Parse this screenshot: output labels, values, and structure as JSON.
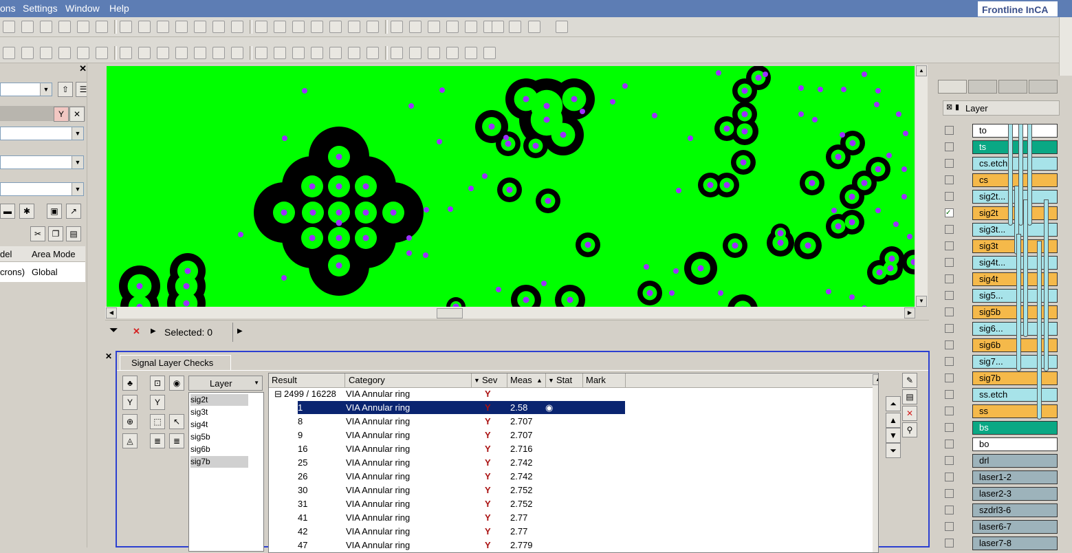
{
  "menu": [
    "ons",
    "Settings",
    "Window",
    "Help"
  ],
  "brand": "Frontline InCA",
  "left_panel": {
    "mode_headers": [
      "del",
      "Area Mode"
    ],
    "mode_values": [
      "crons)",
      "Global"
    ]
  },
  "selection": {
    "label": "Selected: 0"
  },
  "bottom": {
    "tab_label": "Signal Layer Checks",
    "layer_dropdown": "Layer",
    "layers": [
      "sig2t",
      "sig3t",
      "sig4t",
      "sig5b",
      "sig6b",
      "sig7b"
    ],
    "columns": [
      "Result",
      "Category",
      "Sev",
      "Meas",
      "Stat",
      "Mark"
    ],
    "group_row": {
      "result": "2499 / 16228",
      "category": "VIA Annular ring"
    },
    "rows": [
      {
        "result": "1",
        "category": "VIA Annular ring",
        "meas": "2.58",
        "selected": true
      },
      {
        "result": "8",
        "category": "VIA Annular ring",
        "meas": "2.707"
      },
      {
        "result": "9",
        "category": "VIA Annular ring",
        "meas": "2.707"
      },
      {
        "result": "16",
        "category": "VIA Annular ring",
        "meas": "2.716"
      },
      {
        "result": "25",
        "category": "VIA Annular ring",
        "meas": "2.742"
      },
      {
        "result": "26",
        "category": "VIA Annular ring",
        "meas": "2.742"
      },
      {
        "result": "30",
        "category": "VIA Annular ring",
        "meas": "2.752"
      },
      {
        "result": "31",
        "category": "VIA Annular ring",
        "meas": "2.752"
      },
      {
        "result": "41",
        "category": "VIA Annular ring",
        "meas": "2.77"
      },
      {
        "result": "42",
        "category": "VIA Annular ring",
        "meas": "2.77"
      },
      {
        "result": "47",
        "category": "VIA Annular ring",
        "meas": "2.779"
      }
    ]
  },
  "right_panel": {
    "layer_header": "Layer",
    "layers": [
      {
        "name": "to",
        "color": "#ffffff"
      },
      {
        "name": "ts",
        "color": "#0aa884"
      },
      {
        "name": "cs.etch",
        "color": "#a7e3e9"
      },
      {
        "name": "cs",
        "color": "#f5b94a"
      },
      {
        "name": "sig2t...",
        "color": "#a7e3e9"
      },
      {
        "name": "sig2t",
        "color": "#f5b94a",
        "checked": true
      },
      {
        "name": "sig3t...",
        "color": "#a7e3e9"
      },
      {
        "name": "sig3t",
        "color": "#f5b94a"
      },
      {
        "name": "sig4t...",
        "color": "#a7e3e9"
      },
      {
        "name": "sig4t",
        "color": "#f5b94a"
      },
      {
        "name": "sig5...",
        "color": "#a7e3e9"
      },
      {
        "name": "sig5b",
        "color": "#f5b94a"
      },
      {
        "name": "sig6...",
        "color": "#a7e3e9"
      },
      {
        "name": "sig6b",
        "color": "#f5b94a"
      },
      {
        "name": "sig7...",
        "color": "#a7e3e9"
      },
      {
        "name": "sig7b",
        "color": "#f5b94a"
      },
      {
        "name": "ss.etch",
        "color": "#a7e3e9"
      },
      {
        "name": "ss",
        "color": "#f5b94a"
      },
      {
        "name": "bs",
        "color": "#0aa884"
      },
      {
        "name": "bo",
        "color": "#ffffff"
      },
      {
        "name": "drl",
        "color": "#9db3bb"
      },
      {
        "name": "laser1-2",
        "color": "#9db3bb"
      },
      {
        "name": "laser2-3",
        "color": "#9db3bb"
      },
      {
        "name": "szdrl3-6",
        "color": "#9db3bb"
      },
      {
        "name": "laser6-7",
        "color": "#9db3bb"
      },
      {
        "name": "laser7-8",
        "color": "#9db3bb"
      }
    ]
  },
  "colors": {
    "canvas_bg": "#00ff00",
    "pad": "#000000",
    "via": "#9b30ff",
    "selection": "#0a2470",
    "panel_border": "#2b3fd1"
  }
}
